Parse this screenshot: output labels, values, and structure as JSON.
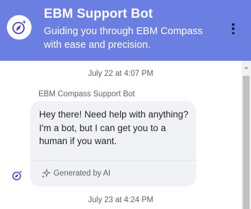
{
  "header": {
    "title": "EBM Support Bot",
    "subtitle": "Guiding you through EBM Compass with ease and precision.",
    "avatar_icon": "compass-logo-icon",
    "menu_icon": "more-vertical-icon"
  },
  "chat": {
    "date_separators": [
      "July 22 at 4:07 PM",
      "July 23 at 4:24 PM"
    ],
    "messages": [
      {
        "sender": "EBM Compass Support Bot",
        "text": "Hey there! Need help with anything? I'm a bot, but I can get you to a human if you want.",
        "footer": "Generated by AI"
      }
    ]
  },
  "colors": {
    "header_bg": "#6b7fe3",
    "bubble_bg": "#f1f2f5",
    "logo": "#4b3fc9"
  }
}
